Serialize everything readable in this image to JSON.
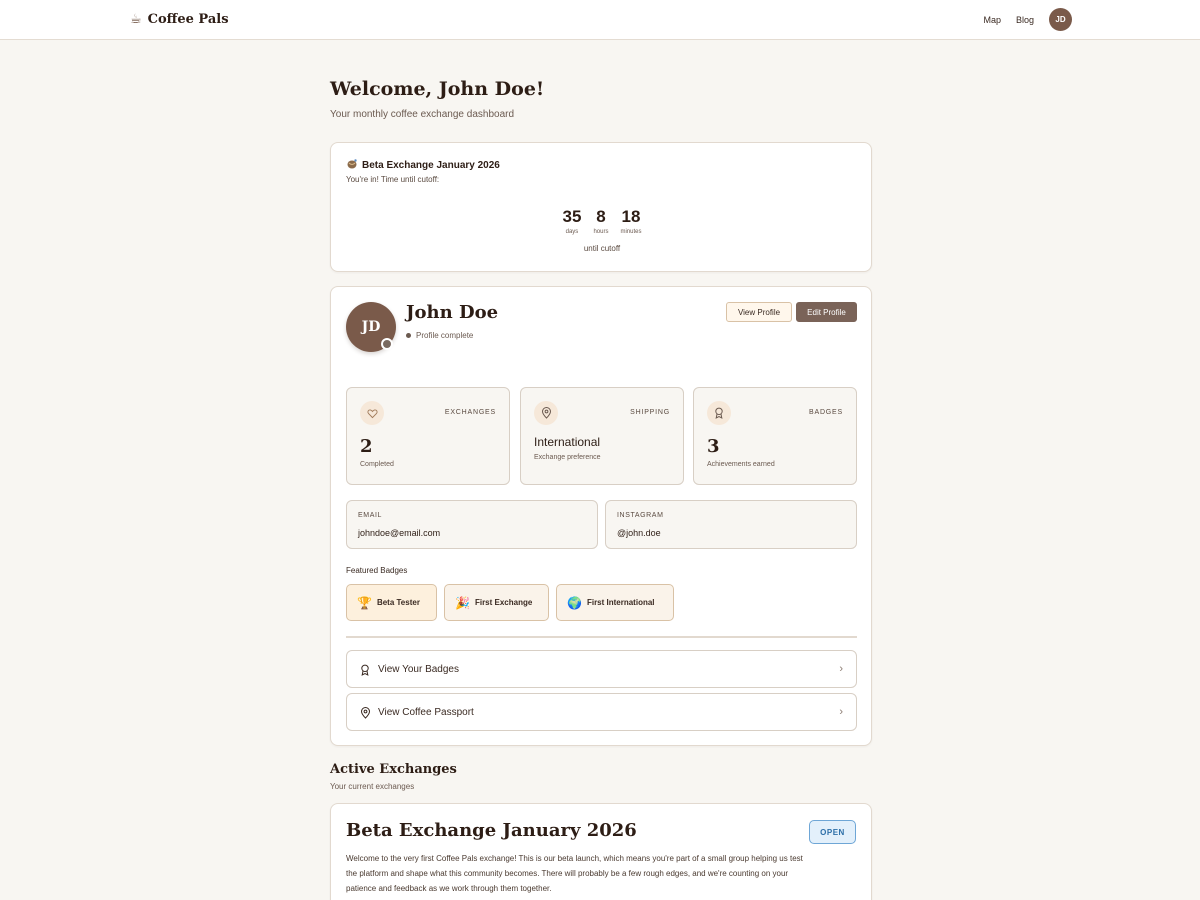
{
  "header": {
    "brand_name": "Coffee Pals",
    "brand_icon": "coffee-cup-icon",
    "nav": [
      "Map",
      "Blog"
    ],
    "user_initials": "JD"
  },
  "welcome": {
    "title": "Welcome, John Doe!",
    "subtitle": "Your monthly coffee exchange dashboard"
  },
  "countdown": {
    "title": "Beta Exchange January 2026",
    "title_icon": "coffee-bean-icon",
    "status": "You're in! Time until cutoff:",
    "units": [
      {
        "value": "35",
        "label": "days"
      },
      {
        "value": "8",
        "label": "hours"
      },
      {
        "value": "18",
        "label": "minutes"
      }
    ],
    "footer": "until cutoff"
  },
  "profile": {
    "initials": "JD",
    "name": "John Doe",
    "status": "Profile complete",
    "view_button": "View Profile",
    "edit_button": "Edit Profile",
    "stats": [
      {
        "caption": "EXCHANGES",
        "value": "2",
        "note": "Completed",
        "icon": "heart-icon"
      },
      {
        "caption": "SHIPPING",
        "value": "International",
        "note": "Exchange preference",
        "icon": "map-pin-icon"
      },
      {
        "caption": "BADGES",
        "value": "3",
        "note": "Achievements earned",
        "icon": "award-icon"
      }
    ],
    "email_label": "EMAIL",
    "email": "johndoe@email.com",
    "instagram_label": "INSTAGRAM",
    "instagram": "@john.doe",
    "featured_badges_title": "Featured Badges",
    "badges": [
      {
        "label": "Beta Tester",
        "icon": "trophy-icon"
      },
      {
        "label": "First Exchange",
        "icon": "party-popper-icon"
      },
      {
        "label": "First International",
        "icon": "globe-icon"
      }
    ],
    "links": [
      {
        "label": "View Your Badges",
        "icon": "award-icon"
      },
      {
        "label": "View Coffee Passport",
        "icon": "map-pin-icon"
      }
    ]
  },
  "active_exchanges": {
    "title": "Active Exchanges",
    "subtitle": "Your current exchanges",
    "card": {
      "title": "Beta Exchange January 2026",
      "status": "OPEN",
      "description": "Welcome to the very first Coffee Pals exchange! This is our beta launch, which means you're part of a small group helping us test the platform and shape what this community becomes. There will probably be a few rough edges, and we're counting on your patience and feedback as we work through them together."
    }
  },
  "colors": {
    "background": "#f8f6f2",
    "brand_brown": "#7a5a4a",
    "open_blue": "#2d6fa8"
  }
}
